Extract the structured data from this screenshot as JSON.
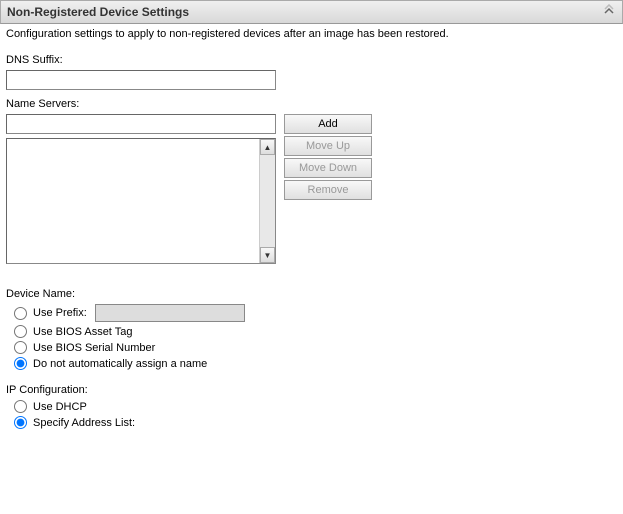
{
  "panel": {
    "title": "Non-Registered Device Settings",
    "collapse_icon": "⊼"
  },
  "description": "Configuration settings to apply to non-registered devices after an image has been restored.",
  "dns": {
    "label": "DNS Suffix:",
    "value": ""
  },
  "name_servers": {
    "label": "Name Servers:",
    "input_value": "",
    "add_label": "Add",
    "move_up_label": "Move Up",
    "move_down_label": "Move Down",
    "remove_label": "Remove",
    "scroll_up": "▲",
    "scroll_down": "▼"
  },
  "device_name": {
    "label": "Device Name:",
    "options": {
      "use_prefix": "Use Prefix:",
      "use_bios_asset": "Use BIOS Asset Tag",
      "use_bios_serial": "Use BIOS Serial Number",
      "no_auto": "Do not automatically assign a name"
    },
    "prefix_value": ""
  },
  "ip_config": {
    "label": "IP Configuration:",
    "options": {
      "use_dhcp": "Use DHCP",
      "specify_list": "Specify Address List:"
    }
  }
}
